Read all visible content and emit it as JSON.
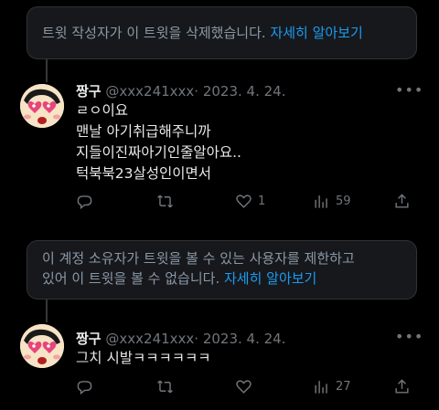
{
  "notice1": {
    "text": "트윗 작성자가 이 트윗을 삭제했습니다. ",
    "link": "자세히 알아보기"
  },
  "tweet1": {
    "name": "짱구",
    "handle": "@xxx241xxx",
    "date": "· 2023. 4. 24.",
    "lines": [
      "ㄹㅇ이요",
      "맨날 아기취급해주니까",
      "지들이진짜아기인줄알아요..",
      "턱북북23살성인이면서"
    ],
    "likes": "1",
    "views": "59"
  },
  "notice2": {
    "line1": "이 계정 소유자가 트윗을 볼 수 있는 사용자를 제한하고",
    "line2": "있어 이 트윗을 볼 수 없습니다. ",
    "link": "자세히 알아보기"
  },
  "tweet2": {
    "name": "짱구",
    "handle": "@xxx241xxx",
    "date": "· 2023. 4. 24.",
    "text": "그치 시발ㅋㅋㅋㅋㅋㅋ",
    "views": "27"
  },
  "icons": {
    "more": "more-icon",
    "reply": "reply-icon",
    "retweet": "retweet-icon",
    "like": "heart-icon",
    "views": "views-icon",
    "share": "share-icon"
  },
  "colors": {
    "background": "#000000",
    "text": "#e7e9ea",
    "secondary": "#71767b",
    "link": "#1d9bf0",
    "notice_bg": "#16181c"
  }
}
